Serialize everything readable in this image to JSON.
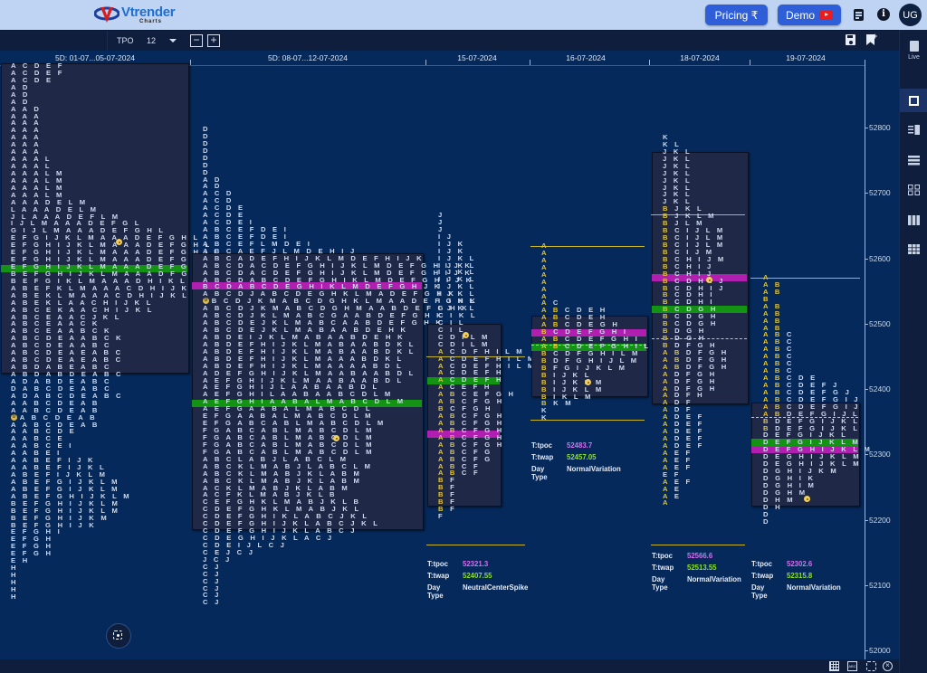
{
  "app": {
    "brand": "Vtrender",
    "brand_sub": "Charts",
    "pricing_label": "Pricing ₹",
    "demo_label": "Demo",
    "avatar_initials": "UG",
    "colors": {
      "topbar": "#bfd3f2",
      "button": "#2f5fd8",
      "poc": "#b01fb0",
      "vwap": "#149214",
      "tpo_text": "#cfdcf0",
      "ib_yellow": "#e7c62a"
    }
  },
  "toolbar": {
    "mode_label": "TPO",
    "mode_value": "12",
    "zoom_out": "−",
    "zoom_in": "+"
  },
  "sidebar": {
    "live_label": "Live",
    "items": [
      "single-chart",
      "split-left",
      "rows-layout",
      "grid-2x2",
      "columns-3",
      "grid-3x3"
    ]
  },
  "axis": {
    "ticks": [
      52800,
      52700,
      52600,
      52500,
      52400,
      52300,
      52200,
      52100,
      52000
    ]
  },
  "sessions": [
    {
      "label": "5D: 01-07...05-07-2024",
      "top_price": 52896,
      "va": {
        "high": 52896,
        "low": 52440
      },
      "poc_row": 28,
      "poc_color": "vwap",
      "open_row": 49,
      "close_row": 23,
      "rows": [
        "A C D E F",
        "A C D E F",
        "A C D E",
        "A D",
        "A D",
        "A D",
        "A A D",
        "A A A",
        "A A A",
        "A A A",
        "A A A",
        "A A A",
        "A A A",
        "A A A L",
        "A A A L",
        "A A A L M",
        "A A A L M",
        "A A A L M",
        "A A A L M",
        "A A A D E L M",
        "L A A A D E L M",
        "J L A A A D E F L M",
        "I J L M A A A D E F G L",
        "G I J L M A A A D E F G H L",
        "E F G I J K L M A A A D E F G H L",
        "E F G H I J K L M A A A D E F G H L",
        "E F G H I J K L M A A A D E F G H I L",
        "E F G H I J K L M A A A D E F G H I L",
        "E F G H I J K L M A A A D E F G H I L",
        "B E F G H I J K L M A A A D F G H I L",
        "B E F G I K L M A A A D H I K L",
        "A B E F K L M A A A C D H I J K L",
        "A B E K L M A A A C D H I J K L",
        "A B E K L A A C H I J K L",
        "A B C E K A A C H I J K L",
        "A B C E A A C J K L",
        "A B C E A A C K",
        "A B C E A A B C K",
        "A B C D E A A B C K",
        "A B C D E A A B C",
        "A B C D E A E A B C",
        "A B C D E A E A B C",
        "A B D A B E A B C",
        "A B D A B D E A B C",
        "A D A B D E A B C",
        "D A B C D E A B C",
        "A D A B C D E A B C",
        "A A B C D E A B",
        "A A B C D E A B",
        "A A B C D E A B",
        "A A B C D E A B",
        "A A B C D E",
        "A A B C E",
        "A A B C E I",
        "A A B E I",
        "A A B E F I J K",
        "A A B E F I J K L",
        "A B E F I J K L M",
        "A B E F G I J K L M",
        "A B E F G I J K L M",
        "A B E F G H I J K L M",
        "B E F G H I J K L M",
        "B E F G H I J K L M",
        "B E F G H I J K M",
        "B E F G H I J K",
        "E F G H I",
        "E F G H",
        "E F G H",
        "E F G H",
        "E H",
        "H",
        "H",
        "H",
        "H",
        "H"
      ]
    },
    {
      "label": "5D: 08-07...12-07-2024",
      "top_price": 52806,
      "poc_row": 22,
      "poc_color": "poc",
      "vwap_row": 38,
      "open_row": 24,
      "close_row": 42,
      "rows": [
        "D",
        "D",
        "D",
        "D",
        "D",
        "D",
        "D",
        "A D",
        "A D",
        "A C D",
        "A C D",
        "A C D E",
        "A C D E",
        "A C D E I",
        "A B C E F D E I",
        "A B C E F D E I",
        "A B C E F L M D E I",
        "A B C A E F J L M D E H I J",
        "A B C A D E F H I J K L M D E F H I J K",
        "A B C D A C D E F G H I J K L M D E F G H I J K",
        "A B C D A C D E F G H I J K L M D E F G H I J K",
        "A B C D A B C D E F G H I K L M D E F G H I J K",
        "B C D A B C D E G H I K L M D E F G H J K",
        "A B C D J A B C D E G H K L M A D E F G H K",
        "A B C D J K M A B C D G H K L M A A D E F G H K",
        "A B C D J K M A B C D G H M A A B D E F G H K",
        "A B C D J K L M A B C G A A B D E F G H K",
        "A B C D E J K L M A B C A A B D E F G H K",
        "A B C D E J K L M A B A A B D E H K",
        "A B D E I J K L M A B A A B D E H K",
        "A B D E F H I J K L M A B A A B D K L",
        "A B D E F H I J K L M A B A A B D K L",
        "A B D E F H I J K L M A A A B D K L",
        "A B D E F H I J K L M A A A A B D L",
        "A D E F G H I J K L M A A B A A B D L",
        "A E F G H I J K L M A A B A A B D L",
        "A E F G H I J L A A B A A B D L",
        "A E F G H I L A A B A A B C D L M",
        "A E F G H I A A B A L M A B C D L M",
        "A E F G A A B A L M A B C D L",
        "E F G A A B A L M A B C D L M",
        "E F G A B C A B L M A B C D L M",
        "F G A B C A B L M A B C D L M",
        "F G A B C A B L M A B C D L M",
        "F G A B C A B L M A B C D L M",
        "F G A B C A B L M A B C D L M",
        "A B C L A B J L A B C L M",
        "A B C K L M A B J L A B C L M",
        "A B C K L M A B J K L A B M",
        "A B C K L M A B J K L A B M",
        "A C K L M A B J K L A B M",
        "A C F K L M A B J K L B",
        "C E F G H K L M A B J K L B",
        "C D E F G H K L M A B J K L",
        "C D E F G H I K L A B C J K L",
        "C D E F G H I J K L A B C J K L",
        "C D E F G H I J K L A B C J",
        "C D E G H I J K L A C J",
        "C D E I J L C J",
        "C E J C J",
        "J C J",
        "C J",
        "C J",
        "C J",
        "C J",
        "C J",
        "C J"
      ],
      "va": {
        "top_row": 17,
        "bottom_row": 52
      }
    },
    {
      "label": "15-07-2024",
      "top_price": 52656,
      "ib_high_row": 39,
      "ib_low_row": 65,
      "poc_row": 51,
      "vwap_row": 42,
      "open_row": 47,
      "close_row": 35,
      "va": {
        "top_row": 34,
        "bottom_row": 60
      },
      "rows": [
        "J",
        "J",
        "J",
        "I J",
        "I J K",
        "I J K",
        "I J K L",
        "I J K L",
        "I J K L",
        "I J K L",
        "I J K L",
        "I J K L",
        "I J K L",
        "I J K L",
        "C I K L",
        "C I L",
        "C I L",
        "C D I L M",
        "C D I L M",
        "A C D F H I L M",
        "A C D E F H I L M",
        "A C D E F H I L M",
        "A C D E F H",
        "A C D E F H",
        "A C E F H",
        "A B C E F G H",
        "A B C F G H",
        "B C F G H",
        "A B C F G H",
        "A B C F G H",
        "A B C F G H",
        "A B C F G H",
        "A B C F G H",
        "A B C F G",
        "A B C F G",
        "A B C F",
        "A B C F",
        "B F",
        "B F",
        "B F",
        "B F",
        "B F",
        "F"
      ],
      "stats": {
        "tpoc_label": "T:tpoc",
        "tpoc": "52321.3",
        "twap_label": "T:twap",
        "twap": "52407.55",
        "daytype_label": "Day Type",
        "daytype": "NeutralCenterSpike"
      }
    },
    {
      "label": "16-07-2024",
      "top_price": 52614,
      "rows": [
        "A",
        "A",
        "A",
        "A",
        "A",
        "A",
        "A",
        "A",
        "A C",
        "A B C D E H",
        "A B C D E H",
        "A B C D E G H",
        "B C D E F G H I",
        "A B C D E F G H I",
        "A B C D E F G H I L M",
        "B C D F G H I L M",
        "B D F G H I J L M",
        "B F G I J K L M",
        "B I J K L",
        "B I J K L M",
        "B I J K L M",
        "B I K L M",
        "B K M",
        "K",
        "K"
      ],
      "stats": {
        "tpoc_label": "T:tpoc",
        "tpoc": "52483.7",
        "twap_label": "T:twap",
        "twap": "52457.05",
        "daytype_label": "Day Type",
        "daytype": "NormalVariation"
      }
    },
    {
      "label": "18-07-2024",
      "top_price": 52786,
      "rows": [
        "K",
        "K L",
        "J K L",
        "J K L",
        "J K L",
        "J K L",
        "J K L",
        "J K L",
        "J K L",
        "J K L",
        "B J K L",
        "B J K L M",
        "B J L M",
        "B C I J L M",
        "B C I J L M",
        "B C I J L M",
        "B C I J M",
        "B C H I J M",
        "B C H I J",
        "B C H I J",
        "B C D H I J",
        "B C D H I J",
        "B C D H I",
        "B C D H I",
        "B C D G H",
        "B C D G H",
        "B C D G H",
        "B D G H",
        "B D G H",
        "B D F G H",
        "A B D F G H",
        "A B D F G H",
        "A B D F G H",
        "A D F G H",
        "A D F G H",
        "A D F G H",
        "A D F H",
        "A D F",
        "A D F",
        "A D E F",
        "A D E F",
        "A D E F",
        "A D E F",
        "A D E F",
        "A E F",
        "A E F",
        "A E F",
        "E F",
        "A E F",
        "A E",
        "A E",
        "A"
      ],
      "stats": {
        "tpoc_label": "T:tpoc",
        "tpoc": "52566.6",
        "twap_label": "T:twap",
        "twap": "52513.55",
        "daytype_label": "Day Type",
        "daytype": "NormalVariation"
      }
    },
    {
      "label": "19-07-2024",
      "top_price": 52567,
      "rows": [
        "A",
        "A B",
        "A B",
        "B",
        "A B",
        "A B",
        "A B",
        "A B",
        "A B C",
        "A B C",
        "A B C",
        "A B C",
        "A B C",
        "A B C",
        "A B C D E",
        "A B C D E F J",
        "A B C D E F G J",
        "A B C D E F G I J",
        "A B C D E F G I J",
        "A B D E F G I J L",
        "B D E F G I J K L",
        "B D E F G I J K L",
        "D E F G I J K L",
        "D E F G I J K L M",
        "D E F G H I J K L M",
        "D E G H I J K L M",
        "D E G H I J K L M",
        "D G H I J K M",
        "D G H I K",
        "D G H I M",
        "D G H M",
        "D H M",
        "D H",
        "D",
        "D"
      ],
      "stats": {
        "tpoc_label": "T:tpoc",
        "tpoc": "52302.6",
        "twap_label": "T:twap",
        "twap": "52315.8",
        "daytype_label": "Day Type",
        "daytype": "NormalVariation"
      }
    }
  ]
}
